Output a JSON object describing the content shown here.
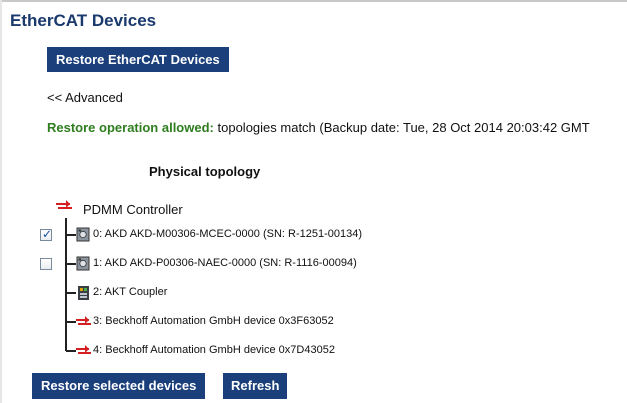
{
  "page": {
    "title": "EtherCAT Devices"
  },
  "toolbar": {
    "restore_ethercat_label": "Restore EtherCAT Devices",
    "advanced_link": "<< Advanced"
  },
  "status": {
    "label": "Restore operation allowed:",
    "message": "topologies match (Backup date: Tue, 28 Oct 2014 20:03:42 GMT"
  },
  "topology": {
    "heading": "Physical topology",
    "root": {
      "label": "PDMM Controller",
      "icon": "ethernet-connector-icon"
    },
    "devices": [
      {
        "label": "0: AKD AKD-M00306-MCEC-0000 (SN: R-1251-00134)",
        "icon": "drive-icon",
        "checkbox": true,
        "checked": true
      },
      {
        "label": "1: AKD AKD-P00306-NAEC-0000 (SN: R-1116-00094)",
        "icon": "drive-icon",
        "checkbox": true,
        "checked": false
      },
      {
        "label": "2: AKT Coupler",
        "icon": "coupler-icon",
        "checkbox": false
      },
      {
        "label": "3: Beckhoff Automation GmbH device 0x3F63052",
        "icon": "ethernet-connector-icon",
        "checkbox": false
      },
      {
        "label": "4: Beckhoff Automation GmbH device 0x7D43052",
        "icon": "ethernet-connector-icon",
        "checkbox": false
      }
    ]
  },
  "footer": {
    "restore_selected_label": "Restore selected devices",
    "refresh_label": "Refresh"
  },
  "colors": {
    "title": "#1a3a6d",
    "button_bg": "#1a3f7a",
    "status_ok": "#2e7d1f",
    "connector": "#d42020"
  }
}
